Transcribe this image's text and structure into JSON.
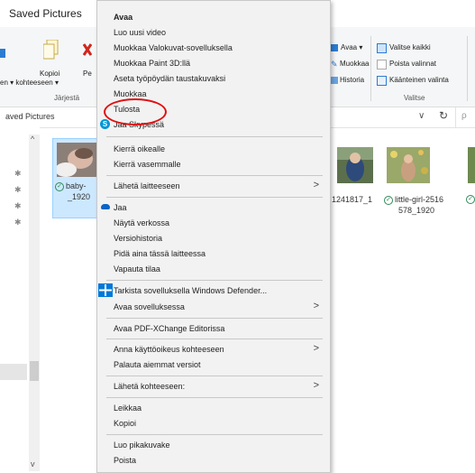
{
  "window": {
    "title": "Saved Pictures"
  },
  "ribbon": {
    "copy_label": "Kopioi",
    "paste_label": "Pe",
    "move_to_label": "en ▾ kohteeseen ▾",
    "organize_group": "Järjestä",
    "open_label": "Avaa ▾",
    "edit_label": "Muokkaa",
    "history_label": "Historia",
    "select_all_label": "Valitse kaikki",
    "select_none_label": "Poista valinnat",
    "invert_selection_label": "Käänteinen valinta",
    "select_group": "Valitse"
  },
  "address": {
    "path": "aved Pictures",
    "dropdown": "∨",
    "refresh": "↻",
    "search": "ρ"
  },
  "files": [
    {
      "name_line1": "baby-",
      "name_line2": "_1920",
      "selected": true
    },
    {
      "name_line1": "1241817_1",
      "name_line2": "",
      "selected": false
    },
    {
      "name_line1": "little-girl-2516",
      "name_line2": "578_1920",
      "selected": false
    }
  ],
  "context_menu": {
    "open": "Avaa",
    "new_video": "Luo uusi video",
    "edit_photos": "Muokkaa Valokuvat-sovelluksella",
    "edit_paint3d": "Muokkaa Paint 3D:llä",
    "set_background": "Aseta työpöydän taustakuvaksi",
    "edit": "Muokkaa",
    "print": "Tulosta",
    "share_skype": "Jaa Skypessä",
    "rotate_right": "Kierrä oikealle",
    "rotate_left": "Kierrä vasemmalle",
    "send_to_device": "Lähetä laitteeseen",
    "share": "Jaa",
    "view_online": "Näytä verkossa",
    "version_history": "Versiohistoria",
    "keep_on_device": "Pidä aina tässä laitteessa",
    "free_space": "Vapauta tilaa",
    "defender_scan": "Tarkista sovelluksella Windows Defender...",
    "open_with": "Avaa sovelluksessa",
    "open_pdfxchange": "Avaa PDF-XChange Editorissa",
    "give_access": "Anna käyttöoikeus kohteeseen",
    "restore_versions": "Palauta aiemmat versiot",
    "send_to": "Lähetä kohteeseen:",
    "cut": "Leikkaa",
    "copy": "Kopioi",
    "create_shortcut": "Luo pikakuvake",
    "delete": "Poista"
  }
}
